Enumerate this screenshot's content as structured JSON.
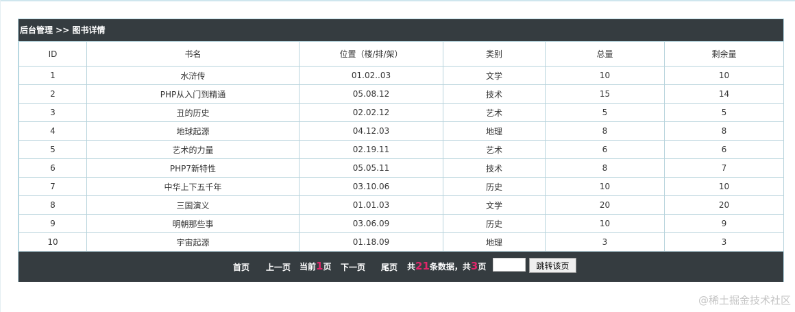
{
  "header": {
    "title": "后台管理 >> 图书详情"
  },
  "table": {
    "columns": [
      "ID",
      "书名",
      "位置（楼/排/架）",
      "类别",
      "总量",
      "剩余量"
    ],
    "rows": [
      [
        "1",
        "水浒传",
        "01.02..03",
        "文学",
        "10",
        "10"
      ],
      [
        "2",
        "PHP从入门到精通",
        "05.08.12",
        "技术",
        "15",
        "14"
      ],
      [
        "3",
        "丑的历史",
        "02.02.12",
        "艺术",
        "5",
        "5"
      ],
      [
        "4",
        "地球起源",
        "04.12.03",
        "地理",
        "8",
        "8"
      ],
      [
        "5",
        "艺术的力量",
        "02.19.11",
        "艺术",
        "6",
        "6"
      ],
      [
        "6",
        "PHP7新特性",
        "05.05.11",
        "技术",
        "8",
        "7"
      ],
      [
        "7",
        "中华上下五千年",
        "03.10.06",
        "历史",
        "10",
        "10"
      ],
      [
        "8",
        "三国演义",
        "01.01.03",
        "文学",
        "20",
        "20"
      ],
      [
        "9",
        "明朝那些事",
        "03.06.09",
        "历史",
        "10",
        "9"
      ],
      [
        "10",
        "宇宙起源",
        "01.18.09",
        "地理",
        "3",
        "3"
      ]
    ]
  },
  "pager": {
    "first": "首页",
    "prev": "上一页",
    "current_prefix": "当前",
    "current_page": "1",
    "current_suffix": "页",
    "next": "下一页",
    "last": "尾页",
    "total_prefix": "共",
    "total_records": "21",
    "total_mid": "条数据，共",
    "total_pages": "3",
    "total_suffix": "页",
    "jump_value": "",
    "jump_button": "跳转该页"
  },
  "watermark": "@稀土掘金技术社区",
  "colors": {
    "bar": "#353c40",
    "accent": "#e0266a",
    "border": "#b7d3dc"
  }
}
